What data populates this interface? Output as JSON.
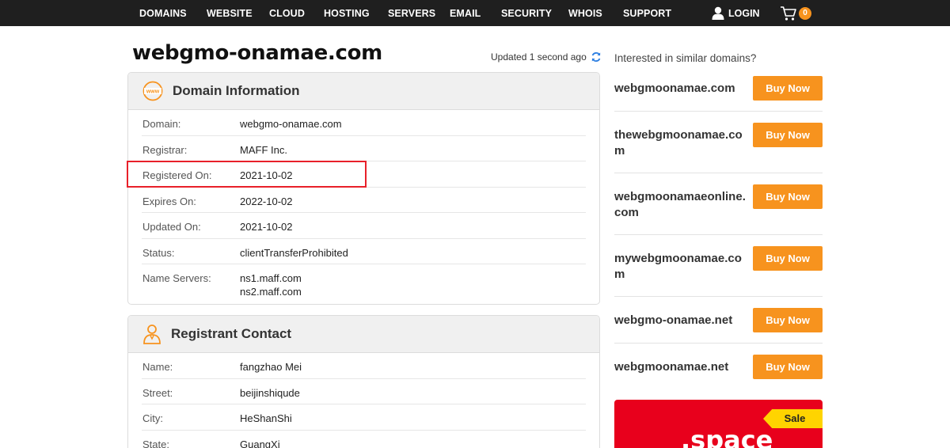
{
  "nav": {
    "items": [
      "DOMAINS",
      "WEBSITE",
      "CLOUD",
      "HOSTING",
      "SERVERS",
      "EMAIL",
      "SECURITY",
      "WHOIS",
      "SUPPORT"
    ],
    "login": "LOGIN",
    "cart_count": "0"
  },
  "header": {
    "domain": "webgmo-onamae.com",
    "updated": "Updated 1 second ago"
  },
  "domain_info": {
    "title": "Domain Information",
    "rows": [
      {
        "label": "Domain:",
        "value": "webgmo-onamae.com"
      },
      {
        "label": "Registrar:",
        "value": "MAFF Inc."
      },
      {
        "label": "Registered On:",
        "value": "2021-10-02"
      },
      {
        "label": "Expires On:",
        "value": "2022-10-02"
      },
      {
        "label": "Updated On:",
        "value": "2021-10-02"
      },
      {
        "label": "Status:",
        "value": "clientTransferProhibited"
      },
      {
        "label": "Name Servers:",
        "value": "ns1.maff.com",
        "value2": "ns2.maff.com"
      }
    ]
  },
  "registrant": {
    "title": "Registrant Contact",
    "rows": [
      {
        "label": "Name:",
        "value": "fangzhao Mei"
      },
      {
        "label": "Street:",
        "value": "beijinshiqude"
      },
      {
        "label": "City:",
        "value": "HeShanShi"
      },
      {
        "label": "State:",
        "value": "GuangXi"
      }
    ]
  },
  "suggestions": {
    "heading": "Interested in similar domains?",
    "buy_label": "Buy Now",
    "items": [
      "webgmoonamae.com",
      "thewebgmoonamae.com",
      "webgmoonamaeonline.com",
      "mywebgmoonamae.com",
      "webgmo-onamae.net",
      "webgmoonamae.net"
    ]
  },
  "promo": {
    "badge": "Sale",
    "text": ".space"
  },
  "colors": {
    "nav_bg": "#1f1f1f",
    "accent": "#f7931e",
    "highlight": "#e8202a",
    "promo": "#e8001c"
  }
}
